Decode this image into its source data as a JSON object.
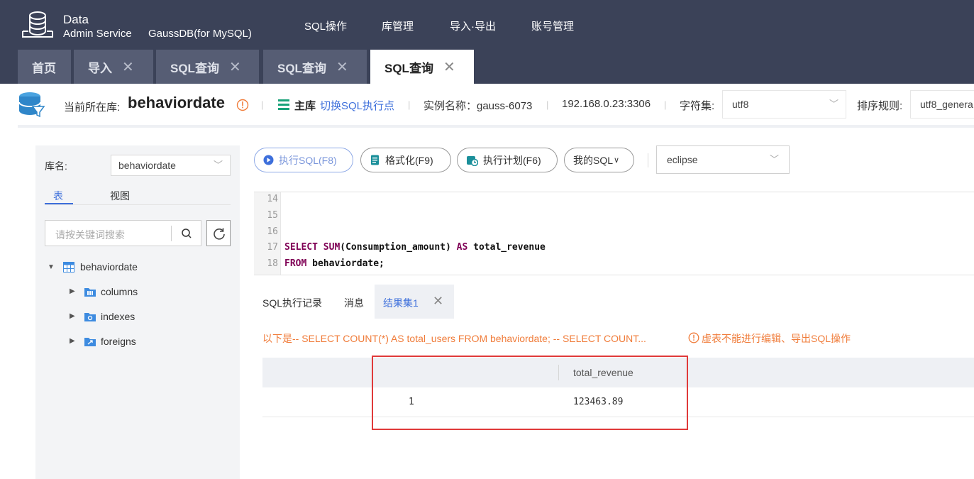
{
  "brand": {
    "line1": "Data",
    "line2": "Admin Service",
    "product": "GaussDB(for MySQL)"
  },
  "menu": [
    "SQL操作",
    "库管理",
    "导入·导出",
    "账号管理"
  ],
  "tabs": [
    {
      "label": "首页"
    },
    {
      "label": "导入",
      "close": "✕"
    },
    {
      "label": "SQL查询",
      "close": "✕"
    },
    {
      "label": "SQL查询",
      "close": "✕"
    },
    {
      "label": "SQL查询",
      "close": "✕"
    }
  ],
  "info": {
    "current_db_label": "当前所在库:",
    "current_db": "behaviordate",
    "master_label": "主库",
    "switch_link": "切换SQL执行点",
    "instance": "实例名称：gauss-6073",
    "address": "192.168.0.23:3306",
    "charset_label": "字符集:",
    "charset_value": "utf8",
    "collation_label": "排序规则:",
    "collation_value": "utf8_genera"
  },
  "left_panel": {
    "db_label": "库名:",
    "db_value": "behaviordate",
    "tab_tables": "表",
    "tab_views": "视图",
    "search_placeholder": "请按关键词搜索",
    "tree": {
      "root": "behaviordate",
      "children": [
        "columns",
        "indexes",
        "foreigns"
      ]
    }
  },
  "toolbar": {
    "execute": "执行SQL(F8)",
    "format": "格式化(F9)",
    "plan": "执行计划(F6)",
    "my_sql": "我的SQL",
    "theme": "eclipse"
  },
  "editor": {
    "lines": [
      {
        "num": "14",
        "text": ""
      },
      {
        "num": "15",
        "text": ""
      },
      {
        "num": "16",
        "text": ""
      },
      {
        "num": "17",
        "text": "SELECT SUM(Consumption_amount) AS total_revenue"
      },
      {
        "num": "18",
        "text": "FROM behaviordate;"
      }
    ]
  },
  "result_tabs": {
    "history": "SQL执行记录",
    "messages": "消息",
    "result": "结果集1",
    "close": "✕"
  },
  "notice": {
    "sql": "以下是-- SELECT COUNT(*) AS total_users FROM behaviordate; -- SELECT COUNT...",
    "warning": "虚表不能进行编辑、导出SQL操作"
  },
  "result_table": {
    "columns": [
      "",
      "total_revenue"
    ],
    "rows": [
      {
        "index": "1",
        "total_revenue": "123463.89"
      }
    ]
  },
  "colors": {
    "nav_bg": "#3b4258",
    "accent": "#3d6fdb",
    "warning": "#f07c3a",
    "highlight": "#e03a3a"
  }
}
